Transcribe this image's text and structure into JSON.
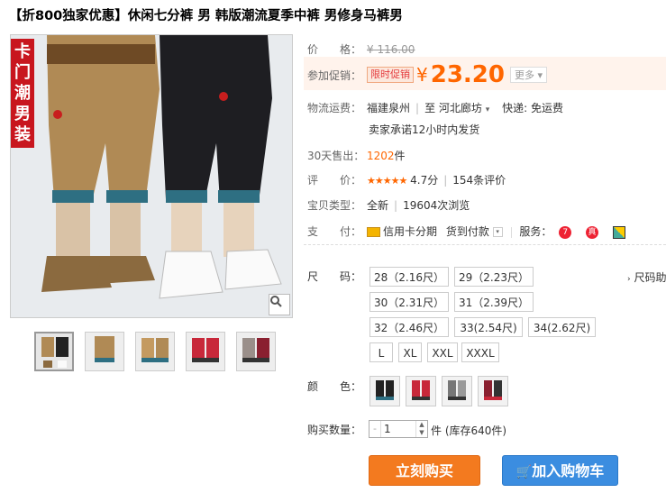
{
  "title": "【折800独家优惠】休闲七分裤 男 韩版潮流夏季中裤 男修身马裤男",
  "image": {
    "badge": "卡门潮男装"
  },
  "thumbnails": [
    "black-khaki-pair",
    "khaki-solo",
    "khaki-pair",
    "red-pair",
    "plaid-pair"
  ],
  "price": {
    "label": "价　　格：",
    "original": "¥ 116.00"
  },
  "promo": {
    "label": "参加促销：",
    "tag": "限时促销",
    "currency": "¥",
    "value": "23.20",
    "more": "更多"
  },
  "shipping": {
    "label": "物流运费：",
    "from": "福建泉州",
    "to_prefix": "至",
    "to": "河北廊坊",
    "fee": "快递: 免运费",
    "promise": "卖家承诺12小时内发货"
  },
  "sales": {
    "label": "30天售出：",
    "count": "1202",
    "unit": "件"
  },
  "rating": {
    "label": "评　　价：",
    "stars": "★★★★★",
    "score": "4.7分",
    "reviews": "154条评价"
  },
  "condition": {
    "label": "宝贝类型：",
    "type": "全新",
    "views": "19604次浏览"
  },
  "payment": {
    "label": "支　　付：",
    "credit": "信用卡分期",
    "cod": "货到付款",
    "service_label": "服务："
  },
  "size": {
    "label": "尺　　码：",
    "options": [
      "28（2.16尺）",
      "29（2.23尺）",
      "30（2.31尺）",
      "31（2.39尺）",
      "32（2.46尺）",
      "33(2.54尺)",
      "34(2.62尺)",
      "L",
      "XL",
      "XXL",
      "XXXL"
    ],
    "chart_link": "尺码助"
  },
  "color": {
    "label": "颜　　色：",
    "swatches": [
      "black",
      "red",
      "grey",
      "red-black"
    ]
  },
  "quantity": {
    "label": "购买数量：",
    "value": "1",
    "stock": "件 (库存640件)"
  },
  "actions": {
    "buy": "立刻购买",
    "cart": "加入购物车"
  },
  "colors": {
    "accent": "#f37a1f",
    "cart": "#3b8de0",
    "price": "#ff6600",
    "badge": "#c8161e"
  }
}
